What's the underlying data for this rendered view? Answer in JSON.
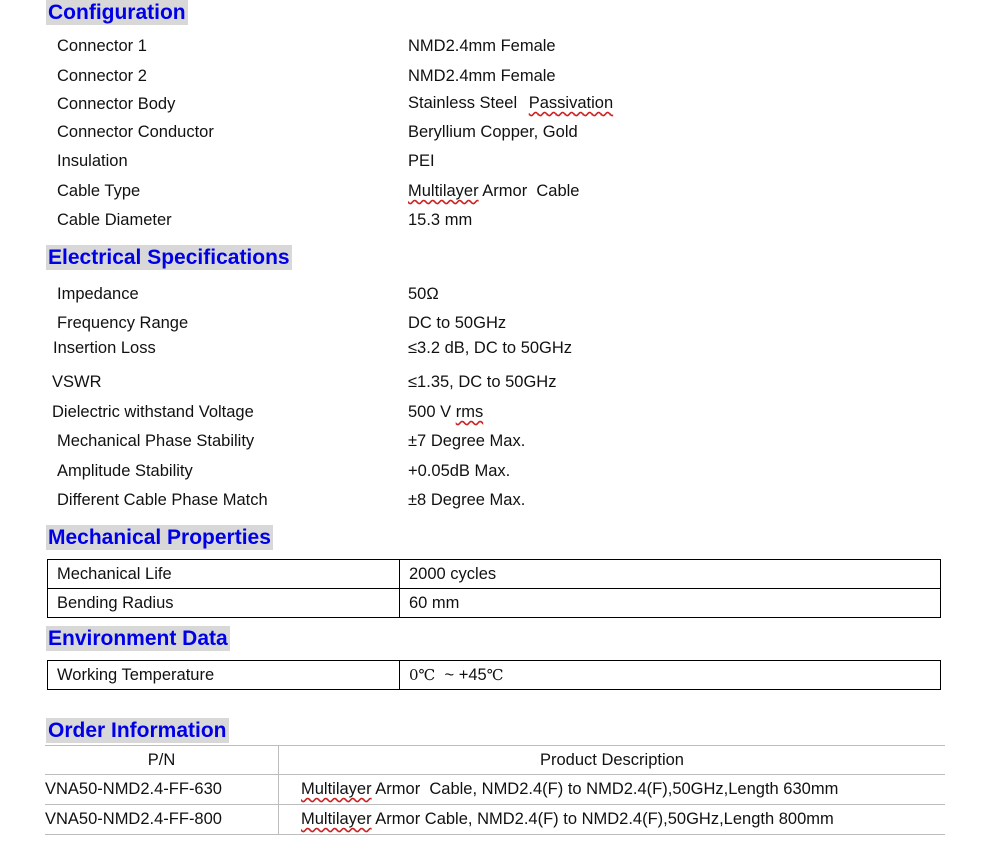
{
  "configuration": {
    "heading": "Configuration",
    "rows": [
      {
        "label": "Connector 1",
        "value": "NMD2.4mm Female"
      },
      {
        "label": "Connector 2",
        "value": "NMD2.4mm Female"
      },
      {
        "label": "Connector Body",
        "value_a": "Stainless Steel",
        "value_b": "Passivation"
      },
      {
        "label": "Connector Conductor",
        "value": "Beryllium Copper, Gold"
      },
      {
        "label": "Insulation",
        "value": "PEI"
      },
      {
        "label": "Cable Type",
        "value_a": "Multilayer",
        "value_b": " Armor  Cable"
      },
      {
        "label": "Cable Diameter",
        "value": "15.3 mm"
      }
    ]
  },
  "electrical": {
    "heading": "Electrical Specifications",
    "rows": [
      {
        "label": "Impedance",
        "value": "50Ω"
      },
      {
        "label": "Frequency Range",
        "value": "DC to 50GHz"
      },
      {
        "label": "Insertion Loss",
        "value": "≤3.2 dB, DC to 50GHz"
      },
      {
        "label": "VSWR",
        "value": "≤1.35, DC to 50GHz"
      },
      {
        "label": "Dielectric withstand Voltage",
        "value_a": "500 V ",
        "value_b": "rms"
      },
      {
        "label": "Mechanical Phase Stability",
        "value": "±7 Degree Max."
      },
      {
        "label": "Amplitude Stability",
        "value": "+0.05dB Max."
      },
      {
        "label": "Different Cable Phase Match",
        "value": "±8 Degree Max."
      }
    ]
  },
  "mechanical": {
    "heading": "Mechanical Properties",
    "rows": [
      {
        "label": "Mechanical Life",
        "value": "2000 cycles"
      },
      {
        "label": "Bending Radius",
        "value": "60 mm"
      }
    ]
  },
  "environment": {
    "heading": "Environment Data",
    "rows": [
      {
        "label": "Working Temperature",
        "value_a": "0℃",
        "value_b": "  ~ +45",
        "value_c": "℃"
      }
    ]
  },
  "order": {
    "heading": "Order Information",
    "columns": [
      "P/N",
      "Product Description"
    ],
    "rows": [
      {
        "pn": "VNA50-NMD2.4-FF-630",
        "desc_a": "Multilayer",
        "desc_b": " Armor  Cable, NMD2.4(F) to NMD2.4(F),50GHz,Length 630mm"
      },
      {
        "pn": "VNA50-NMD2.4-FF-800",
        "desc_a": "Multilayer",
        "desc_b": " Armor Cable, NMD2.4(F) to NMD2.4(F),50GHz,Length 800mm"
      }
    ]
  }
}
